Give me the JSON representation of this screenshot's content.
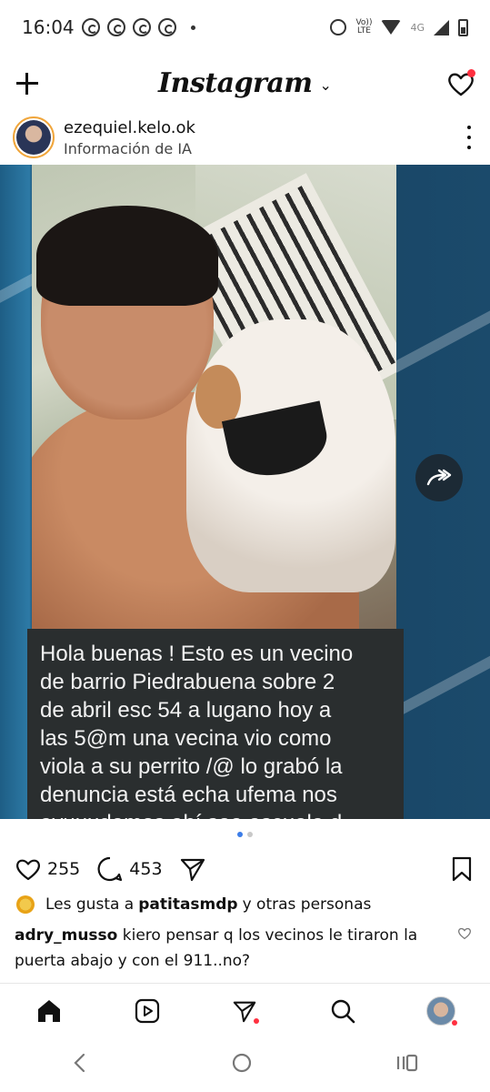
{
  "status_bar": {
    "time": "16:04",
    "volte_top": "Vo))",
    "volte_bottom": "LTE",
    "network": "4G"
  },
  "header": {
    "brand": "Instagram",
    "chevron": "⌄"
  },
  "post": {
    "username": "ezequiel.kelo.ok",
    "subtitle": "Información de IA",
    "caption": "Hola buenas ! Esto es un vecino\nde barrio Piedrabuena  sobre 2\nde abril esc 54 a lugano  hoy a\nlas 5@m una vecina vio como\nviola a su perrito /@ lo grabó la\ndenuncia está echa ufema nos\nayuuudemos ahí sea escuela d",
    "likes_count": "255",
    "comments_count": "453",
    "liked_by_prefix": "Les gusta a",
    "liked_by_user": "patitasmdp",
    "liked_by_suffix": "y otras personas",
    "comment_user": "adry_musso",
    "comment_text": "kiero pensar q los vecinos le tiraron la puerta abajo y con el 911..no?"
  },
  "icons": {
    "plus": "plus-icon",
    "heart": "heart-icon",
    "more": "more-options-icon",
    "share": "share-arrow-icon",
    "comment": "comment-icon",
    "send": "send-icon",
    "bookmark": "bookmark-icon",
    "home": "home-icon",
    "reels": "reels-icon",
    "direct": "direct-messages-icon",
    "search": "search-icon",
    "profile": "profile-avatar"
  },
  "colors": {
    "notification": "#ff3040",
    "carousel_active": "#3c7de8",
    "caption_bg": "#2a2e2f"
  }
}
